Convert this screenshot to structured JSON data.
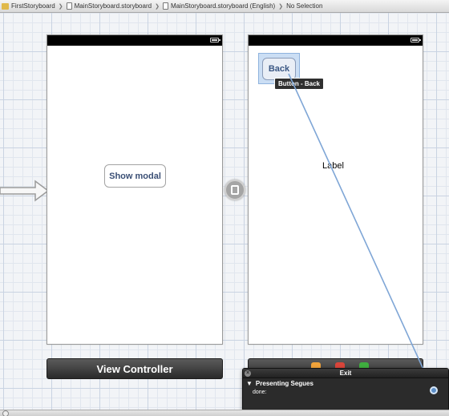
{
  "breadcrumb": {
    "items": [
      "FirstStoryboard",
      "MainStoryboard.storyboard",
      "MainStoryboard.storyboard (English)",
      "No Selection"
    ]
  },
  "scene1": {
    "button_label": "Show modal",
    "dock_title": "View Controller"
  },
  "scene2": {
    "back_button_label": "Back",
    "tooltip": "Button - Back",
    "label_text": "Label"
  },
  "exit_panel": {
    "title": "Exit",
    "section": "Presenting Segues",
    "item": "done:"
  },
  "colors": {
    "connection": "#7fa6d6",
    "dock_icon_1": "#f0a33a",
    "dock_icon_2": "#d9453a",
    "dock_icon_3": "#3fae3f"
  }
}
